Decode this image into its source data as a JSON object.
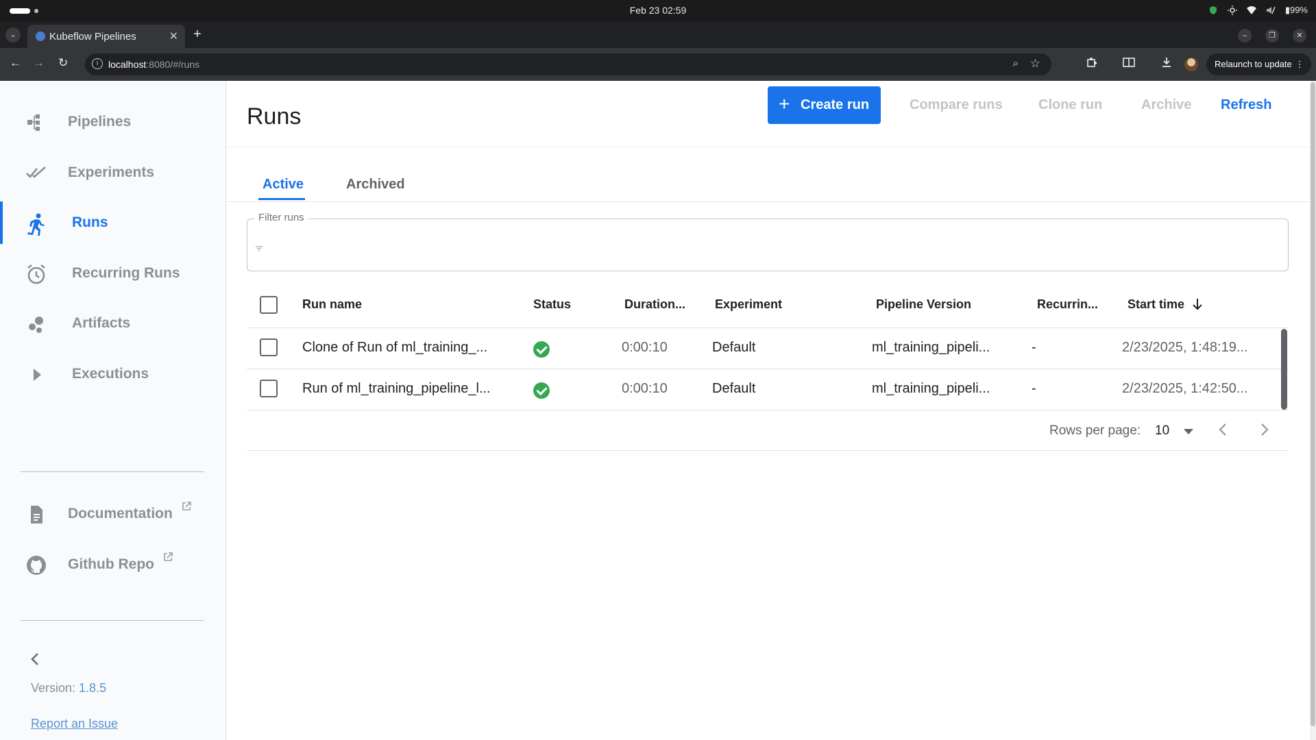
{
  "os": {
    "clock": "Feb 23  02:59",
    "battery": "99%"
  },
  "browser": {
    "tab_title": "Kubeflow Pipelines",
    "url_host": "localhost",
    "url_rest": ":8080/#/runs",
    "relaunch": "Relaunch to update"
  },
  "sidebar": {
    "items": [
      {
        "label": "Pipelines",
        "icon": "pipelines-icon"
      },
      {
        "label": "Experiments",
        "icon": "experiments-icon"
      },
      {
        "label": "Runs",
        "icon": "runs-icon",
        "active": true
      },
      {
        "label": "Recurring Runs",
        "icon": "alarm-icon"
      },
      {
        "label": "Artifacts",
        "icon": "artifacts-icon"
      },
      {
        "label": "Executions",
        "icon": "play-icon"
      },
      {
        "label": "Documentation",
        "icon": "document-icon",
        "external": true
      },
      {
        "label": "Github Repo",
        "icon": "github-icon",
        "external": true
      }
    ],
    "version_label": "Version: ",
    "version": "1.8.5",
    "report": "Report an Issue"
  },
  "header": {
    "title": "Runs",
    "create_run": "Create run",
    "compare_runs": "Compare runs",
    "clone_run": "Clone run",
    "archive": "Archive",
    "refresh": "Refresh"
  },
  "tabs": [
    {
      "label": "Active",
      "active": true
    },
    {
      "label": "Archived"
    }
  ],
  "filter": {
    "label": "Filter runs",
    "value": ""
  },
  "table": {
    "columns": [
      "Run name",
      "Status",
      "Duration...",
      "Experiment",
      "Pipeline Version",
      "Recurrin...",
      "Start time"
    ],
    "rows": [
      {
        "name": "Clone of Run of ml_training_...",
        "status": "succeeded",
        "duration": "0:00:10",
        "experiment": "Default",
        "pipeline_version": "ml_training_pipeli...",
        "recurring": "-",
        "start_time": "2/23/2025, 1:48:19..."
      },
      {
        "name": "Run of ml_training_pipeline_l...",
        "status": "succeeded",
        "duration": "0:00:10",
        "experiment": "Default",
        "pipeline_version": "ml_training_pipeli...",
        "recurring": "-",
        "start_time": "2/23/2025, 1:42:50..."
      }
    ]
  },
  "pagination": {
    "rows_per_page_label": "Rows per page:",
    "rows_per_page": "10"
  },
  "colors": {
    "accent": "#1a73e8",
    "success": "#34a853",
    "sidebar_bg": "#f8fafb",
    "disabled": "#c0c4c8"
  }
}
